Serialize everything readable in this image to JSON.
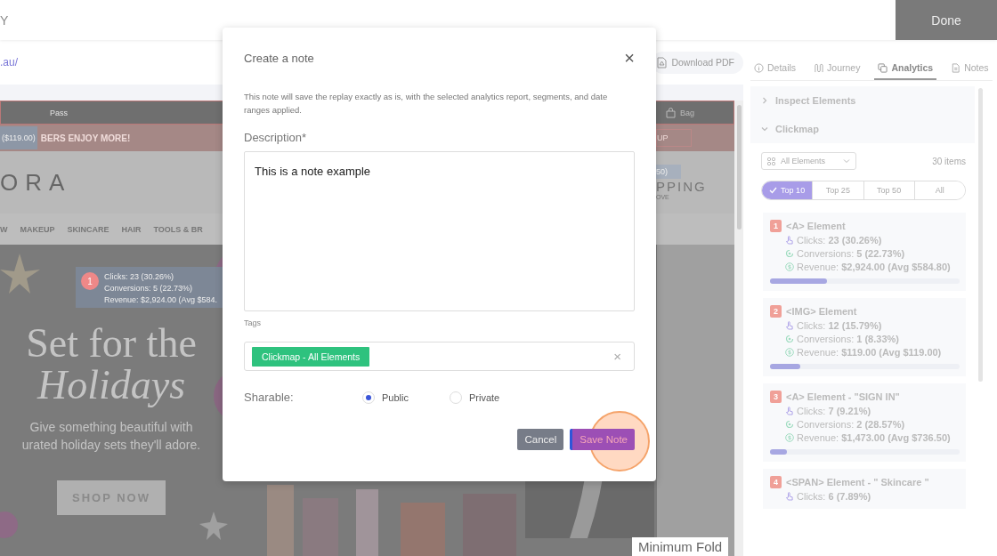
{
  "top_bar": {
    "title": "Y",
    "done_button": "Done"
  },
  "address_bar": {
    "url": ".au/",
    "download_button": "Download PDF"
  },
  "replay": {
    "utility_bar": {
      "left_text": "Pass",
      "bag_label": "Bag"
    },
    "promo_bar": {
      "price_tooltip": "($119.00)",
      "text": "BERS ENJOY MORE!",
      "button_fragment": "UP"
    },
    "logo_row": {
      "logo_fragment": "ORA",
      "tooltip_fragment": "50)",
      "shipping_title": "PPING",
      "shipping_sub": "OVE"
    },
    "nav": [
      "W",
      "MAKEUP",
      "SKINCARE",
      "HAIR",
      "TOOLS & BR"
    ],
    "hotspot": {
      "number": "1",
      "lines": [
        "Clicks: 23 (30.26%)",
        "Conversions: 5 (22.73%)",
        "Revenue: $2,924.00 (Avg $584."
      ]
    },
    "hero": {
      "title": "Set for the",
      "title_italic": "Holidays",
      "lines": [
        "Give something beautiful with",
        "urated holiday sets they'll adore."
      ],
      "button": "SHOP NOW"
    },
    "fold_label": "Minimum Fold"
  },
  "modal": {
    "title": "Create a note",
    "close": "×",
    "intro": "This note will save the replay exactly as is, with the selected analytics report, segments, and date ranges applied.",
    "description_label": "Description*",
    "description_value": "This is a note example",
    "tags_label": "Tags",
    "tags": [
      "Clickmap - All Elements"
    ],
    "tags_clear": "×",
    "sharable_label": "Sharable:",
    "sharable_options": [
      {
        "label": "Public",
        "selected": true
      },
      {
        "label": "Private",
        "selected": false
      }
    ],
    "buttons": [
      {
        "label": "Cancel",
        "kind": "secondary"
      },
      {
        "label": "Save Note",
        "kind": "primary",
        "highlighted": true
      }
    ]
  },
  "side_panel": {
    "tabs": [
      {
        "label": "Details",
        "selected": false
      },
      {
        "label": "Journey",
        "selected": false
      },
      {
        "label": "Analytics",
        "selected": true
      },
      {
        "label": "Notes",
        "selected": false
      }
    ],
    "sections": [
      {
        "title": "Inspect Elements",
        "expanded": false
      },
      {
        "title": "Clickmap",
        "expanded": true
      }
    ],
    "filter": {
      "value": "All Elements"
    },
    "count": "30 items",
    "segments": [
      {
        "label": "Top 10",
        "selected": true
      },
      {
        "label": "Top 25",
        "selected": false
      },
      {
        "label": "Top 50",
        "selected": false
      },
      {
        "label": "All",
        "selected": false
      }
    ],
    "elements": [
      {
        "rank": "1",
        "title": "<A> Element",
        "clicks": "Clicks: **23 (30.26%)**",
        "conversions": "Conversions: **5 (22.73%)**",
        "revenue": "Revenue: **$2,924.00 (Avg $584.80)**",
        "level": 0.3
      },
      {
        "rank": "2",
        "title": "<IMG> Element",
        "clicks": "Clicks: **12 (15.79%)**",
        "conversions": "Conversions: **1 (8.33%)**",
        "revenue": "Revenue: **$119.00 (Avg $119.00)**",
        "level": 0.16
      },
      {
        "rank": "3",
        "title": "<A> Element - \"SIGN IN\"",
        "clicks": "Clicks: **7 (9.21%)**",
        "conversions": "Conversions: **2 (28.57%)**",
        "revenue": "Revenue: **$1,473.00 (Avg $736.50)**",
        "level": 0.09
      },
      {
        "rank": "4",
        "title": "<SPAN> Element - \" Skincare \"",
        "clicks": "Clicks: **6 (7.89%)**"
      }
    ]
  }
}
